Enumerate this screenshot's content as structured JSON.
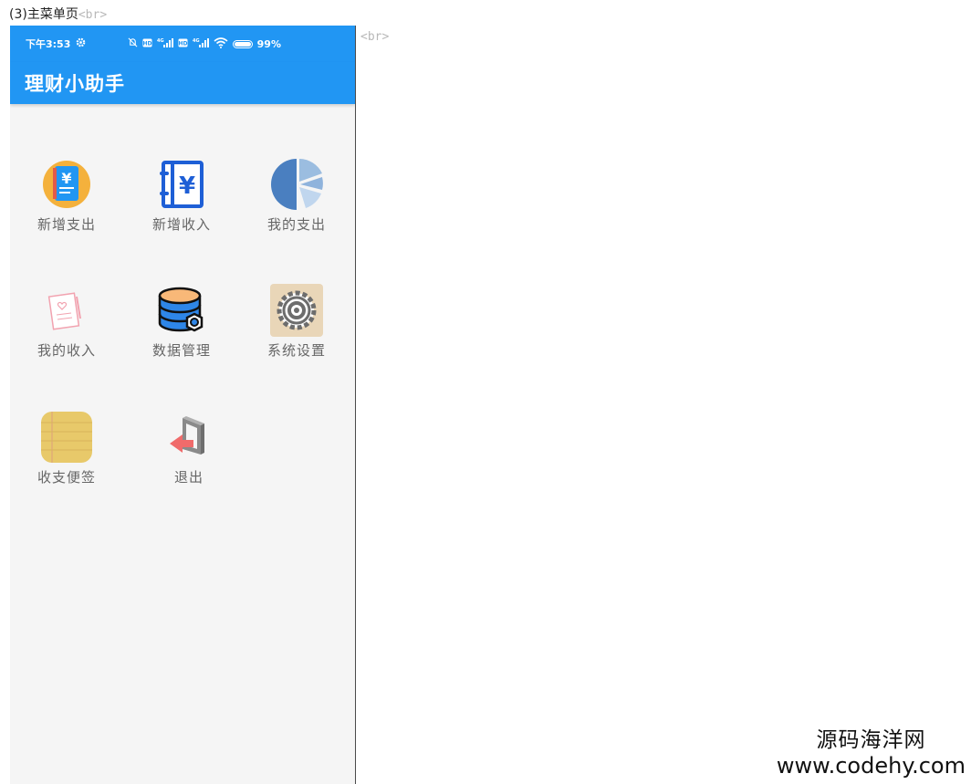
{
  "doc": {
    "heading": "(3)主菜单页",
    "br_tag": "<br>",
    "br_tag_right": "<br>"
  },
  "status_bar": {
    "time": "下午3:53",
    "battery_percent": "99%",
    "icons": [
      "gear-icon",
      "mute-bell-icon",
      "hd-icon",
      "4g-signal-icon",
      "wifi-icon",
      "battery-icon"
    ]
  },
  "app_bar": {
    "title": "理财小助手",
    "color": "#2196f3"
  },
  "menu": {
    "items": [
      {
        "label": "新增支出",
        "icon": "notebook-yuan-icon"
      },
      {
        "label": "新增收入",
        "icon": "ledger-yuan-icon"
      },
      {
        "label": "我的支出",
        "icon": "pie-chart-icon"
      },
      {
        "label": "我的收入",
        "icon": "love-letter-icon"
      },
      {
        "label": "数据管理",
        "icon": "database-gear-icon"
      },
      {
        "label": "系统设置",
        "icon": "settings-gear-icon"
      },
      {
        "label": "收支便签",
        "icon": "sticky-note-icon"
      },
      {
        "label": "退出",
        "icon": "exit-arrow-icon"
      }
    ]
  },
  "watermark": {
    "cn": "源码海洋网",
    "en": "www.codehy.com"
  }
}
